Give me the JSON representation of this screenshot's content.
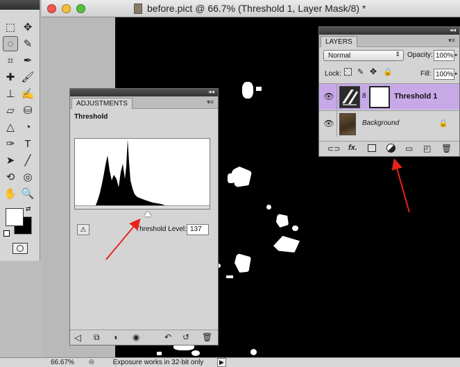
{
  "window": {
    "title": "before.pict @ 66.7% (Threshold 1, Layer Mask/8) *",
    "controls": {
      "close_color": "#f0574f",
      "minimize_color": "#f4bf3a",
      "zoom_color": "#56c13d"
    }
  },
  "toolbox": {
    "tools": [
      {
        "name": "rectangular-marquee-icon",
        "glyph": "⬚"
      },
      {
        "name": "move-icon",
        "glyph": "✥"
      },
      {
        "name": "lasso-icon",
        "glyph": "◌"
      },
      {
        "name": "quick-selection-icon",
        "glyph": "✎"
      },
      {
        "name": "crop-icon",
        "glyph": "⌗"
      },
      {
        "name": "eyedropper-icon",
        "glyph": "✒"
      },
      {
        "name": "spot-healing-icon",
        "glyph": "✚"
      },
      {
        "name": "brush-icon",
        "glyph": "🖌"
      },
      {
        "name": "clone-stamp-icon",
        "glyph": "⊥"
      },
      {
        "name": "history-brush-icon",
        "glyph": "✍"
      },
      {
        "name": "eraser-icon",
        "glyph": "▱"
      },
      {
        "name": "paint-bucket-icon",
        "glyph": "⛁"
      },
      {
        "name": "blur-icon",
        "glyph": "△"
      },
      {
        "name": "dodge-icon",
        "glyph": "◔"
      },
      {
        "name": "pen-icon",
        "glyph": "✑"
      },
      {
        "name": "type-icon",
        "glyph": "T"
      },
      {
        "name": "path-selection-icon",
        "glyph": "➤"
      },
      {
        "name": "line-icon",
        "glyph": "╱"
      },
      {
        "name": "3d-rotate-icon",
        "glyph": "⟲"
      },
      {
        "name": "3d-orbit-icon",
        "glyph": "◎"
      },
      {
        "name": "hand-icon",
        "glyph": "✋"
      },
      {
        "name": "zoom-icon",
        "glyph": "🔍"
      }
    ]
  },
  "adjustments": {
    "tab": "ADJUSTMENTS",
    "heading": "Threshold",
    "threshold_label": "Threshold Level:",
    "threshold_value": "137",
    "threshold_fraction": 0.537
  },
  "layers": {
    "tab": "LAYERS",
    "blend_mode": "Normal",
    "opacity_label": "Opacity:",
    "opacity_value": "100%",
    "lock_label": "Lock:",
    "fill_label": "Fill:",
    "fill_value": "100%",
    "items": [
      {
        "name": "Threshold 1",
        "selected": true,
        "highlight": "#c7a9e8"
      },
      {
        "name": "Background",
        "selected": false
      }
    ]
  },
  "status": {
    "zoom": "66.67%",
    "message": "Exposure works in 32-bit only"
  },
  "annotation": {
    "arrow_color": "#e8231c"
  }
}
